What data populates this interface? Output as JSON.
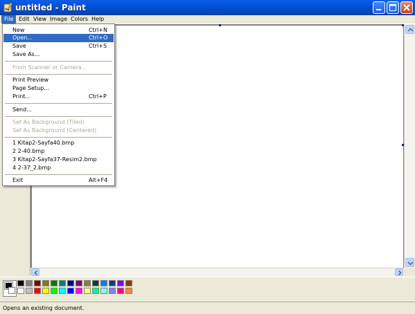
{
  "window": {
    "title": "untitled - Paint",
    "icons": {
      "app": "paint-app-icon",
      "minimize": "minimize-icon",
      "maximize": "maximize-icon",
      "close": "close-icon"
    }
  },
  "menubar": {
    "items": [
      {
        "label": "File",
        "active": true
      },
      {
        "label": "Edit"
      },
      {
        "label": "View"
      },
      {
        "label": "Image"
      },
      {
        "label": "Colors"
      },
      {
        "label": "Help"
      }
    ]
  },
  "file_menu": {
    "new": {
      "label": "New",
      "accel": "Ctrl+N"
    },
    "open": {
      "label": "Open...",
      "accel": "Ctrl+O",
      "highlighted": true
    },
    "save": {
      "label": "Save",
      "accel": "Ctrl+S"
    },
    "save_as": {
      "label": "Save As..."
    },
    "from_scanner": {
      "label": "From Scanner or Camera...",
      "disabled": true
    },
    "print_preview": {
      "label": "Print Preview"
    },
    "page_setup": {
      "label": "Page Setup..."
    },
    "print": {
      "label": "Print...",
      "accel": "Ctrl+P"
    },
    "send": {
      "label": "Send..."
    },
    "bg_tiled": {
      "label": "Set As Background (Tiled)",
      "disabled": true
    },
    "bg_centered": {
      "label": "Set As Background (Centered)",
      "disabled": true
    },
    "recent": [
      "1 Kitap2-Sayfa40.bmp",
      "2 2-40.bmp",
      "3 Kitap2-Sayfa37-Resim2.bmp",
      "4 2-37_2.bmp"
    ],
    "exit": {
      "label": "Exit",
      "accel": "Alt+F4"
    }
  },
  "palette": {
    "foreground": "#000000",
    "background": "#ffffff",
    "top_row": [
      "#000000",
      "#808080",
      "#800000",
      "#808000",
      "#008000",
      "#008080",
      "#000080",
      "#800080",
      "#808040",
      "#004040",
      "#0080ff",
      "#004080",
      "#8000ff",
      "#804000"
    ],
    "bottom_row": [
      "#ffffff",
      "#c0c0c0",
      "#ff0000",
      "#ffff00",
      "#00ff00",
      "#00ffff",
      "#0000ff",
      "#ff00ff",
      "#ffff80",
      "#00ff80",
      "#80ffff",
      "#8080ff",
      "#ff0080",
      "#ff8040"
    ]
  },
  "status": {
    "text": "Opens an existing document."
  }
}
